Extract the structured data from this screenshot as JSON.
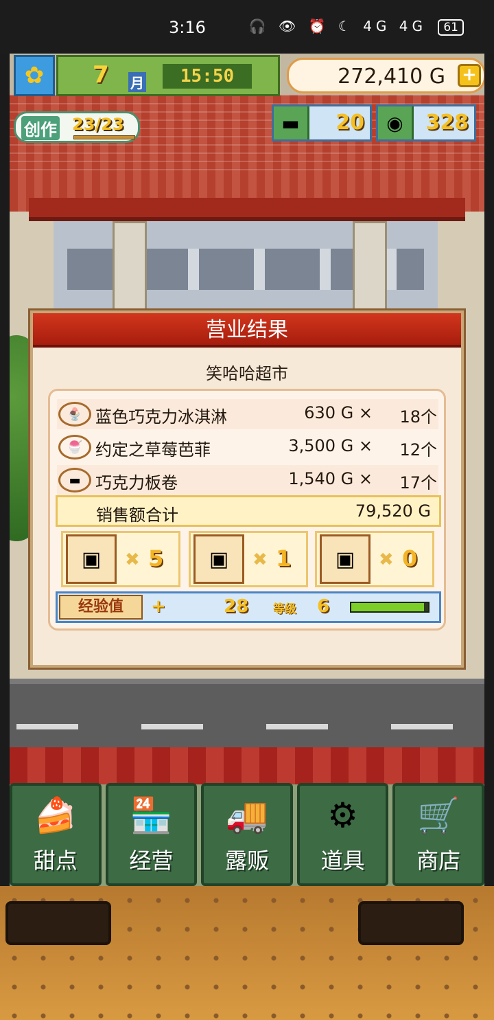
{
  "status_bar": {
    "time": "3:16",
    "icons": "🎧 👁 ⏰ ☾ 4G 4G",
    "battery": "61"
  },
  "top_bar": {
    "month": "7",
    "month_unit": "月",
    "clock": "15:50",
    "gold": "272,410 G",
    "plus": "+"
  },
  "creation": {
    "label": "创作",
    "count": "23/23"
  },
  "resources": [
    {
      "icon": "gold-bar-icon",
      "value": "20"
    },
    {
      "icon": "silver-coin-icon",
      "value": "328"
    }
  ],
  "result_panel": {
    "title": "营业结果",
    "shop_name": "笑哈哈超市",
    "items": [
      {
        "icon": "ice-cream-icon",
        "name": "蓝色巧克力冰淇淋",
        "price": "630 G ×",
        "qty": "18个"
      },
      {
        "icon": "parfait-icon",
        "name": "约定之草莓芭菲",
        "price": "3,500 G ×",
        "qty": "12个"
      },
      {
        "icon": "chocolate-roll-icon",
        "name": "巧克力板卷",
        "price": "1,540 G ×",
        "qty": "17个"
      }
    ],
    "total_label": "销售额合计",
    "total_value": "79,520 G",
    "chests": [
      {
        "icon": "red-chest-icon",
        "x": "✖",
        "count": "5"
      },
      {
        "icon": "silver-chest-icon",
        "x": "✖",
        "count": "1"
      },
      {
        "icon": "gold-chest-icon",
        "x": "✖",
        "count": "0"
      }
    ],
    "exp": {
      "label": "经验值",
      "plus": "+",
      "value": "28",
      "level_label": "等级",
      "level": "6",
      "progress": 0.95
    }
  },
  "bottom_nav": [
    {
      "label": "甜点",
      "icon": "cake-icon"
    },
    {
      "label": "经营",
      "icon": "store-icon"
    },
    {
      "label": "露贩",
      "icon": "food-truck-icon"
    },
    {
      "label": "道具",
      "icon": "gear-bag-icon"
    },
    {
      "label": "商店",
      "icon": "shopping-cart-icon"
    }
  ],
  "colors": {
    "accent_red": "#c2311a",
    "panel_bg": "#f6e9d8",
    "nav_green": "#3d6b44",
    "gold_text": "#f4c026"
  }
}
